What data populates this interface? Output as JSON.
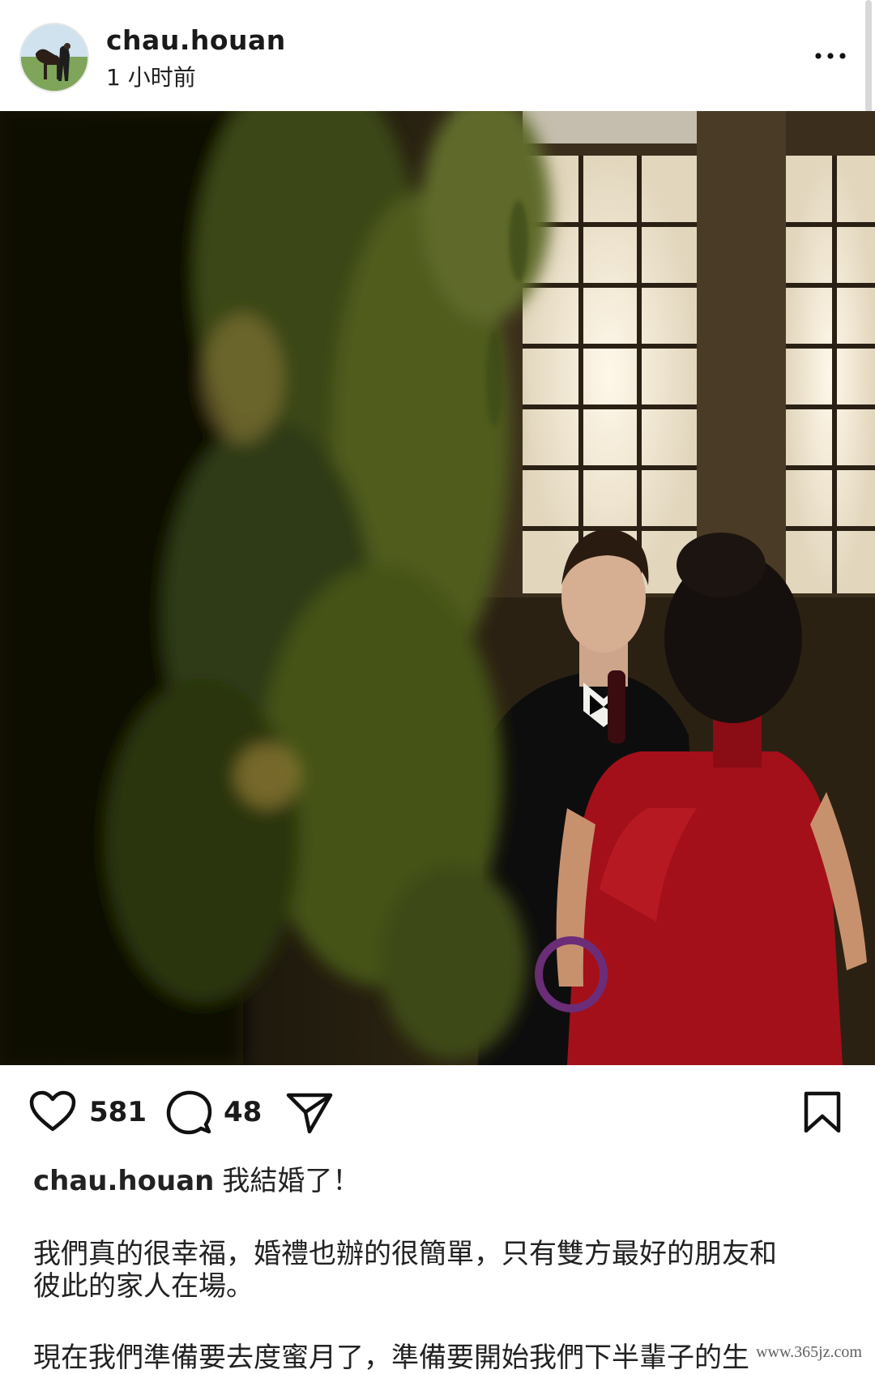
{
  "post": {
    "username": "chau.houan",
    "timestamp": "1 小时前",
    "likes": "581",
    "comments": "48",
    "caption_user": "chau.houan",
    "caption_headline": "我結婚了！",
    "caption_paragraph1_line1": "我們真的很幸福，婚禮也辦的很簡單，只有雙方最好的朋友和",
    "caption_paragraph1_line2": "彼此的家人在場。",
    "caption_paragraph2_partial": "現在我們準備要去度蜜月了，準備要開始我們下半輩子的生"
  },
  "icons": {
    "more": "more-horizontal-icon",
    "like": "heart-icon",
    "comment": "comment-bubble-icon",
    "share": "send-icon",
    "save": "bookmark-icon"
  },
  "watermark": "www.365jz.com",
  "colors": {
    "text": "#1a1a1a",
    "dress": "#a3101a",
    "window": "#e9e2d3"
  }
}
